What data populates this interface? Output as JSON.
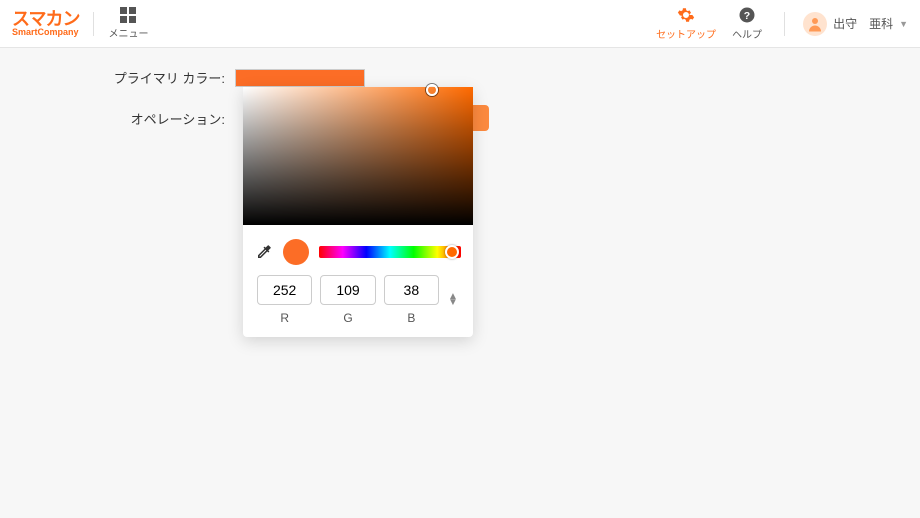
{
  "header": {
    "logo_main": "スマカン",
    "logo_sub": "SmartCompany",
    "menu_label": "メニュー",
    "setup_label": "セットアップ",
    "help_label": "ヘルプ",
    "user_name": "出守　亜科"
  },
  "form": {
    "primary_color_label": "プライマリ カラー:",
    "operation_label": "オペレーション:",
    "primary_color_value": "#fc6d26"
  },
  "picker": {
    "r_label": "R",
    "g_label": "G",
    "b_label": "B",
    "r_value": "252",
    "g_value": "109",
    "b_value": "38",
    "hue_deg": 20,
    "sat_pct": 82,
    "val_pct": 98
  }
}
